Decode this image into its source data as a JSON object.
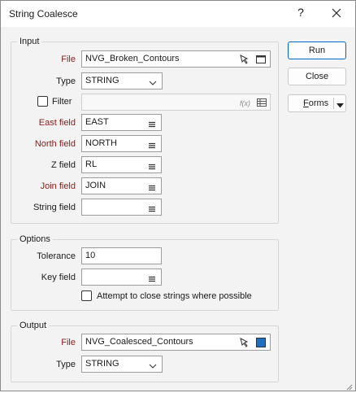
{
  "window": {
    "title": "String Coalesce",
    "help_label": "?"
  },
  "input": {
    "group_title": "Input",
    "file_label": "File",
    "file_value": "NVG_Broken_Contours",
    "type_label": "Type",
    "type_value": "STRING",
    "filter_label": "Filter",
    "filter_value": "",
    "filter_checked": false,
    "east_label": "East field",
    "east_value": "EAST",
    "north_label": "North field",
    "north_value": "NORTH",
    "z_label": "Z field",
    "z_value": "RL",
    "join_label": "Join field",
    "join_value": "JOIN",
    "string_label": "String field",
    "string_value": ""
  },
  "options": {
    "group_title": "Options",
    "tolerance_label": "Tolerance",
    "tolerance_value": "10",
    "key_label": "Key field",
    "key_value": "",
    "close_strings_label": "Attempt to close strings where possible",
    "close_strings_checked": false
  },
  "output": {
    "group_title": "Output",
    "file_label": "File",
    "file_value": "NVG_Coalesced_Contours",
    "type_label": "Type",
    "type_value": "STRING"
  },
  "buttons": {
    "run_label": "Run",
    "close_label": "Close",
    "forms_label": "Forms",
    "forms_underline_char": "F"
  },
  "icons": {
    "pointer": "pointer-icon",
    "browse_window": "window-icon",
    "field_list": "list-icon",
    "function": "function-icon",
    "expression_editor": "grid-icon",
    "dropdown": "chevron-down-icon",
    "color_swatch": "color-swatch-icon"
  },
  "colors": {
    "required_label": "#8b1a1a",
    "primary_border": "#0067c0",
    "output_swatch": "#1e6fbf"
  }
}
